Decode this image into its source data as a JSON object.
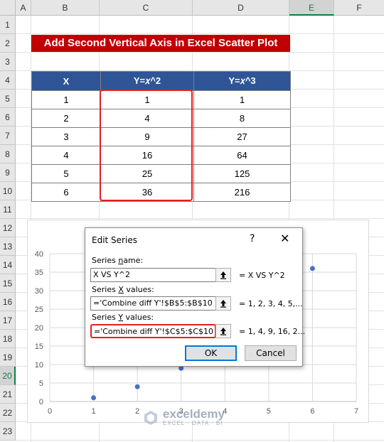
{
  "sheet": {
    "columns": [
      "A",
      "B",
      "C",
      "D",
      "E",
      "F"
    ],
    "selected_column": "E",
    "rows": [
      "1",
      "2",
      "3",
      "4",
      "5",
      "6",
      "7",
      "8",
      "9",
      "10",
      "11",
      "12",
      "13",
      "14",
      "15",
      "16",
      "17",
      "18",
      "19",
      "20",
      "21",
      "22",
      "23"
    ],
    "selected_row": "20"
  },
  "banner": {
    "title": "Add Second  Vertical Axis in Excel Scatter Plot"
  },
  "table": {
    "headers": [
      "X",
      "Y=𝑥^2",
      "Y=𝑥^3"
    ],
    "rows": [
      [
        "1",
        "1",
        "1"
      ],
      [
        "2",
        "4",
        "8"
      ],
      [
        "3",
        "9",
        "27"
      ],
      [
        "4",
        "16",
        "64"
      ],
      [
        "5",
        "25",
        "125"
      ],
      [
        "6",
        "36",
        "216"
      ]
    ]
  },
  "chart_data": {
    "type": "scatter",
    "series": [
      {
        "name": "X VS Y^2",
        "x": [
          1,
          2,
          3,
          4,
          5,
          6
        ],
        "y": [
          1,
          4,
          9,
          16,
          25,
          36
        ]
      }
    ],
    "xlim": [
      0,
      7
    ],
    "ylim": [
      0,
      40
    ],
    "xticks": [
      "0",
      "1",
      "2",
      "3",
      "4",
      "5",
      "6",
      "7"
    ],
    "yticks": [
      "0",
      "5",
      "10",
      "15",
      "20",
      "25",
      "30",
      "35",
      "40"
    ],
    "grid": true,
    "marker_color": "#4472c4"
  },
  "dialog": {
    "title": "Edit Series",
    "help": "?",
    "close": "✕",
    "series_name_label_pre": "Series ",
    "series_name_label_key": "n",
    "series_name_label_post": "ame:",
    "series_name_value": "X VS Y^2",
    "series_name_preview": "= X VS Y^2",
    "x_label_pre": "Series ",
    "x_label_key": "X",
    "x_label_post": " values:",
    "x_value": "='Combine diff Y'!$B$5:$B$10",
    "x_preview": "= 1, 2, 3, 4, 5,...",
    "y_label_pre": "Series ",
    "y_label_key": "Y",
    "y_label_post": " values:",
    "y_value": "='Combine diff Y'!$C$5:$C$10",
    "y_preview": "= 1, 4, 9, 16, 2...",
    "ok_label": "OK",
    "cancel_label": "Cancel"
  },
  "watermark": {
    "name": "exceldemy",
    "tagline": "EXCEL · DATA · BI"
  }
}
